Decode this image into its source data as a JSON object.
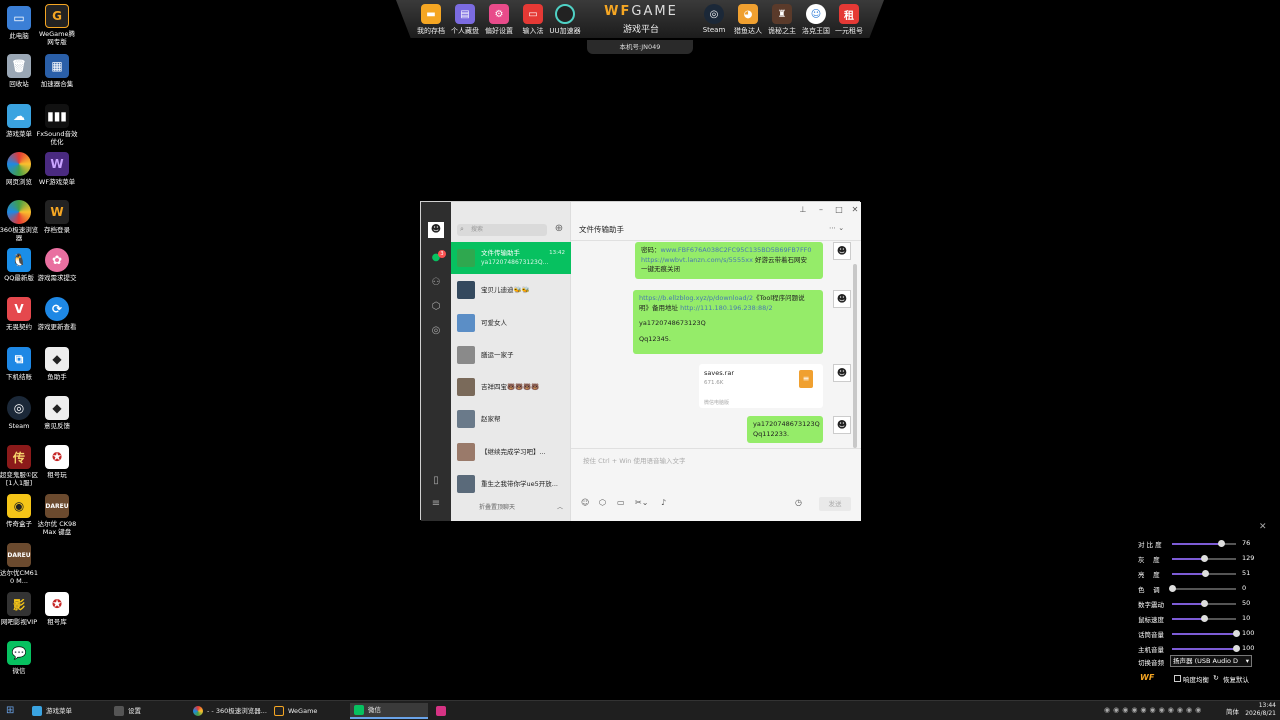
{
  "desktop": {
    "icons": [
      {
        "label": "此电脑"
      },
      {
        "label": "WeGame腾网专版"
      },
      {
        "label": "回收站"
      },
      {
        "label": "加速器合集"
      },
      {
        "label": "游戏菜单"
      },
      {
        "label": "FxSound音效优化"
      },
      {
        "label": "网页浏览"
      },
      {
        "label": "WF游戏菜单"
      },
      {
        "label": "360极速浏览器"
      },
      {
        "label": "存档登录"
      },
      {
        "label": "QQ最新版"
      },
      {
        "label": "游戏需求提交"
      },
      {
        "label": "无畏契约"
      },
      {
        "label": "游戏更新查看"
      },
      {
        "label": "下机结账"
      },
      {
        "label": "鱼助手"
      },
      {
        "label": "Steam"
      },
      {
        "label": "意见反馈"
      },
      {
        "label": "超变鬼服①区[1人1服]"
      },
      {
        "label": "租号玩"
      },
      {
        "label": "传奇盒子"
      },
      {
        "label": "达尔优 CK98 Max 键盘"
      },
      {
        "label": "达尔优CM610 M..."
      },
      {
        "label": "网吧影视VIP"
      },
      {
        "label": "租号库"
      },
      {
        "label": "微信"
      }
    ]
  },
  "topbar": {
    "items_left": [
      {
        "label": "我的存档"
      },
      {
        "label": "个人藏盘"
      },
      {
        "label": "偏好设置"
      },
      {
        "label": "输入法"
      },
      {
        "label": "UU加速器"
      }
    ],
    "logo_a": "WF",
    "logo_b": "GAME",
    "subtitle": "游戏平台",
    "items_right": [
      {
        "label": "Steam"
      },
      {
        "label": "猎鱼达人"
      },
      {
        "label": "诡秘之主"
      },
      {
        "label": "洛克王国"
      },
      {
        "label": "一元租号"
      }
    ],
    "machine": "本机号:JN049"
  },
  "wechat": {
    "search_placeholder": "搜索",
    "chat_title": "文件传输助手",
    "unread": "3",
    "conversations": [
      {
        "name": "文件传输助手",
        "preview": "ya1720748673123Q...",
        "time": "13:42"
      },
      {
        "name": "宝贝儿迪迪🐝🐝"
      },
      {
        "name": "可爱女人"
      },
      {
        "name": "膳运一家子"
      },
      {
        "name": "吉祥四宝🐻🐻🐻🐻"
      },
      {
        "name": "赵家帮"
      },
      {
        "name": "【继续完成学习吧】..."
      },
      {
        "name": "重生之我带你学ue5开放..."
      }
    ],
    "folded": "折叠置顶聊天",
    "messages": {
      "m1_l1a": "密码：",
      "m1_l1b": "www.FBF676A038C2FC95C135BD5B69FB7FF0",
      "m1_l2a": "https://wwbvt.lanzn.com/s/5555xx",
      "m1_l2b": " 好游云带着石网安",
      "m1_l3": "一键无痕关闭",
      "m2_l1a": "https://b.ellzblog.xyz/p/download/2",
      "m2_l1b": "《Tool程序问题说",
      "m2_l2a": "明》备用地址 ",
      "m2_l2b": "http://111.180.196.238:88/2",
      "m2_l3": "ya1720748673123Q",
      "m2_l4": "Qq12345.",
      "file_name": "saves.rar",
      "file_size": "671.6K",
      "file_src": "微信电脑版",
      "m3_l1": "ya1720748673123Q",
      "m3_l2": "Qq112233."
    },
    "input_placeholder": "按住 Ctrl + Win 使用语音输入文字",
    "send_label": "发送"
  },
  "adjust_panel": {
    "rows": [
      {
        "name": "对 比 度",
        "value": "76",
        "pct": 0.76
      },
      {
        "name": "灰　 度",
        "value": "129",
        "pct": 0.5
      },
      {
        "name": "亮　 度",
        "value": "51",
        "pct": 0.51
      },
      {
        "name": "色　 调",
        "value": "0",
        "pct": 0.0
      },
      {
        "name": "数字震动",
        "value": "50",
        "pct": 0.5
      },
      {
        "name": "鼠标速度",
        "value": "10",
        "pct": 0.5
      },
      {
        "name": "话筒音量",
        "value": "100",
        "pct": 1.0
      },
      {
        "name": "主机音量",
        "value": "100",
        "pct": 1.0
      }
    ],
    "audio_label": "切换音频",
    "audio_value": "扬声器 (USB Audio D",
    "logo": "WF",
    "check_label": "响度均衡",
    "reset_label": "恢复默认"
  },
  "taskbar": {
    "tasks": [
      {
        "label": "游戏菜单"
      },
      {
        "label": "设置"
      },
      {
        "label": "- - 360极速浏览器..."
      },
      {
        "label": "WeGame"
      },
      {
        "label": "微信"
      }
    ],
    "lang": "简体",
    "time": "13:44",
    "date": "2026/8/21"
  }
}
